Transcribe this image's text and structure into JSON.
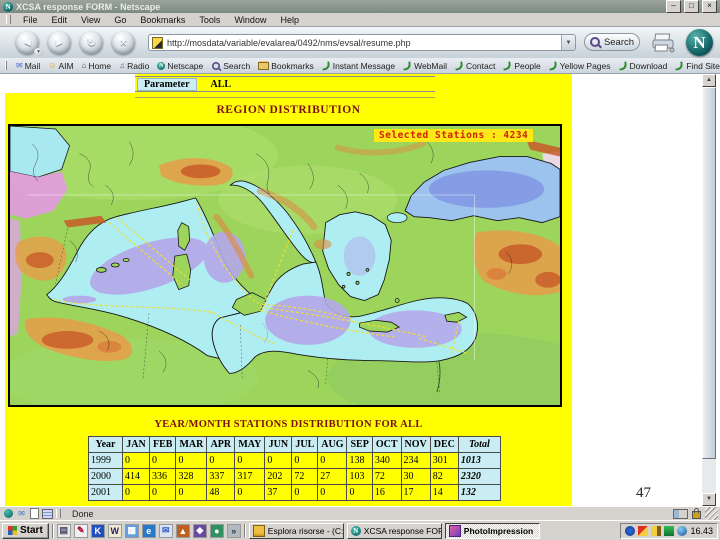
{
  "window": {
    "title": "XCSA response FORM - Netscape"
  },
  "titlebar_controls": {
    "minimize": "–",
    "maximize": "□",
    "close": "×"
  },
  "menu_bar": {
    "items": [
      "File",
      "Edit",
      "View",
      "Go",
      "Bookmarks",
      "Tools",
      "Window",
      "Help"
    ]
  },
  "nav_toolbar": {
    "url": "http://mosdata/variable/evalarea/0492/nms/evsal/resume.php",
    "search_label": "Search"
  },
  "personal_toolbar": {
    "items": [
      "Mail",
      "AIM",
      "Home",
      "Radio",
      "Netscape",
      "Search",
      "Bookmarks",
      "Instant Message",
      "WebMail",
      "Contact",
      "People",
      "Yellow Pages",
      "Download",
      "Find Sites",
      "»"
    ]
  },
  "icons": {
    "back": "◄",
    "forward": "►",
    "reload": "↻",
    "stop": "×",
    "dropdown": "▼",
    "scroll_up": "▲",
    "scroll_down": "▼",
    "window_icon": "N",
    "netscape_n": "N",
    "mail": "✉",
    "aim": "☺",
    "home": "⌂",
    "radio": "♫",
    "overflow": "»",
    "quick_launch_names": [
      "show-desktop",
      "editor",
      "k-app",
      "writer",
      "grid",
      "browser",
      "mail",
      "brush",
      "package",
      "users",
      "media"
    ],
    "tray_names": [
      "network",
      "antivirus",
      "pen",
      "scanner",
      "messenger"
    ],
    "status_component_names": [
      "navigator",
      "mail",
      "composer",
      "addressbook"
    ]
  },
  "page": {
    "parameter_label": "Parameter",
    "parameter_value": "ALL",
    "region_title": "REGION DISTRIBUTION",
    "selected_stations_label": "Selected Stations : 4234",
    "table_title": "YEAR/MONTH STATIONS DISTRIBUTION FOR ALL",
    "slide_number": "47"
  },
  "stations_table": {
    "headers": [
      "Year",
      "JAN",
      "FEB",
      "MAR",
      "APR",
      "MAY",
      "JUN",
      "JUL",
      "AUG",
      "SEP",
      "OCT",
      "NOV",
      "DEC",
      "Total"
    ],
    "rows": [
      [
        "1999",
        "0",
        "0",
        "0",
        "0",
        "0",
        "0",
        "0",
        "0",
        "138",
        "340",
        "234",
        "301",
        "1013"
      ],
      [
        "2000",
        "414",
        "336",
        "328",
        "337",
        "317",
        "202",
        "72",
        "27",
        "103",
        "72",
        "30",
        "82",
        "2320"
      ],
      [
        "2001",
        "0",
        "0",
        "0",
        "48",
        "0",
        "37",
        "0",
        "0",
        "0",
        "16",
        "17",
        "14",
        "132"
      ]
    ]
  },
  "status_bar": {
    "text": "Done"
  },
  "taskbar": {
    "start_label": "Start",
    "tasks": [
      "Esplora risorse - (C:)",
      "XCSA response FORM - N...",
      "PhotoImpression"
    ],
    "clock": "16.43"
  },
  "colors": {
    "page_bg": "#ffff00",
    "cell_blue": "#c9edf2",
    "heading_red": "#7a1212",
    "stations_red": "#cc2200",
    "sea_cyan": "#aeeef2",
    "deep_basin": "#b4a8ea",
    "land_green": "#9cd45c"
  }
}
